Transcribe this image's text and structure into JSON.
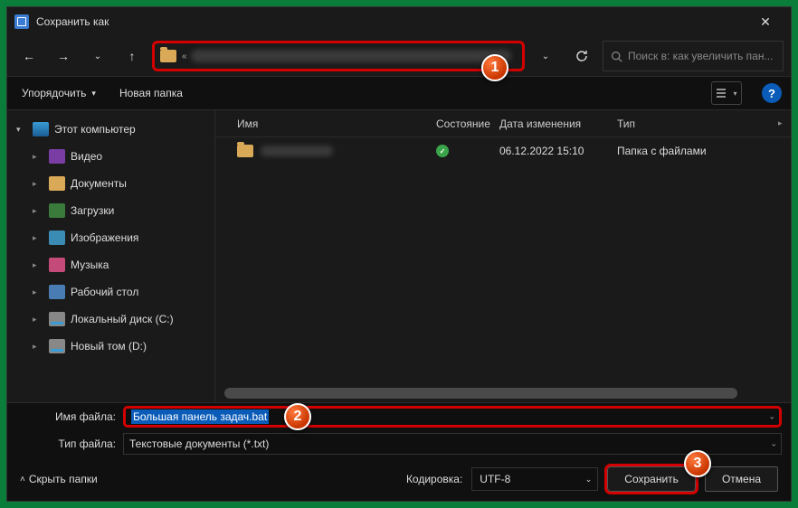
{
  "title": "Сохранить как",
  "search_placeholder": "Поиск в: как увеличить пан...",
  "toolbar": {
    "organize": "Упорядочить",
    "newfolder": "Новая папка"
  },
  "columns": {
    "name": "Имя",
    "state": "Состояние",
    "date": "Дата изменения",
    "type": "Тип"
  },
  "row": {
    "date": "06.12.2022 15:10",
    "type": "Папка с файлами"
  },
  "sidebar": {
    "pc": "Этот компьютер",
    "video": "Видео",
    "docs": "Документы",
    "downloads": "Загрузки",
    "images": "Изображения",
    "music": "Музыка",
    "desktop": "Рабочий стол",
    "diskC": "Локальный диск (C:)",
    "diskD": "Новый том (D:)"
  },
  "form": {
    "filename_label": "Имя файла:",
    "filename_value": "Большая панель задач.bat",
    "filetype_label": "Тип файла:",
    "filetype_value": "Текстовые документы (*.txt)"
  },
  "footer": {
    "hide": "Скрыть папки",
    "encoding_label": "Кодировка:",
    "encoding_value": "UTF-8",
    "save": "Сохранить",
    "cancel": "Отмена"
  },
  "markers": {
    "m1": "1",
    "m2": "2",
    "m3": "3"
  }
}
